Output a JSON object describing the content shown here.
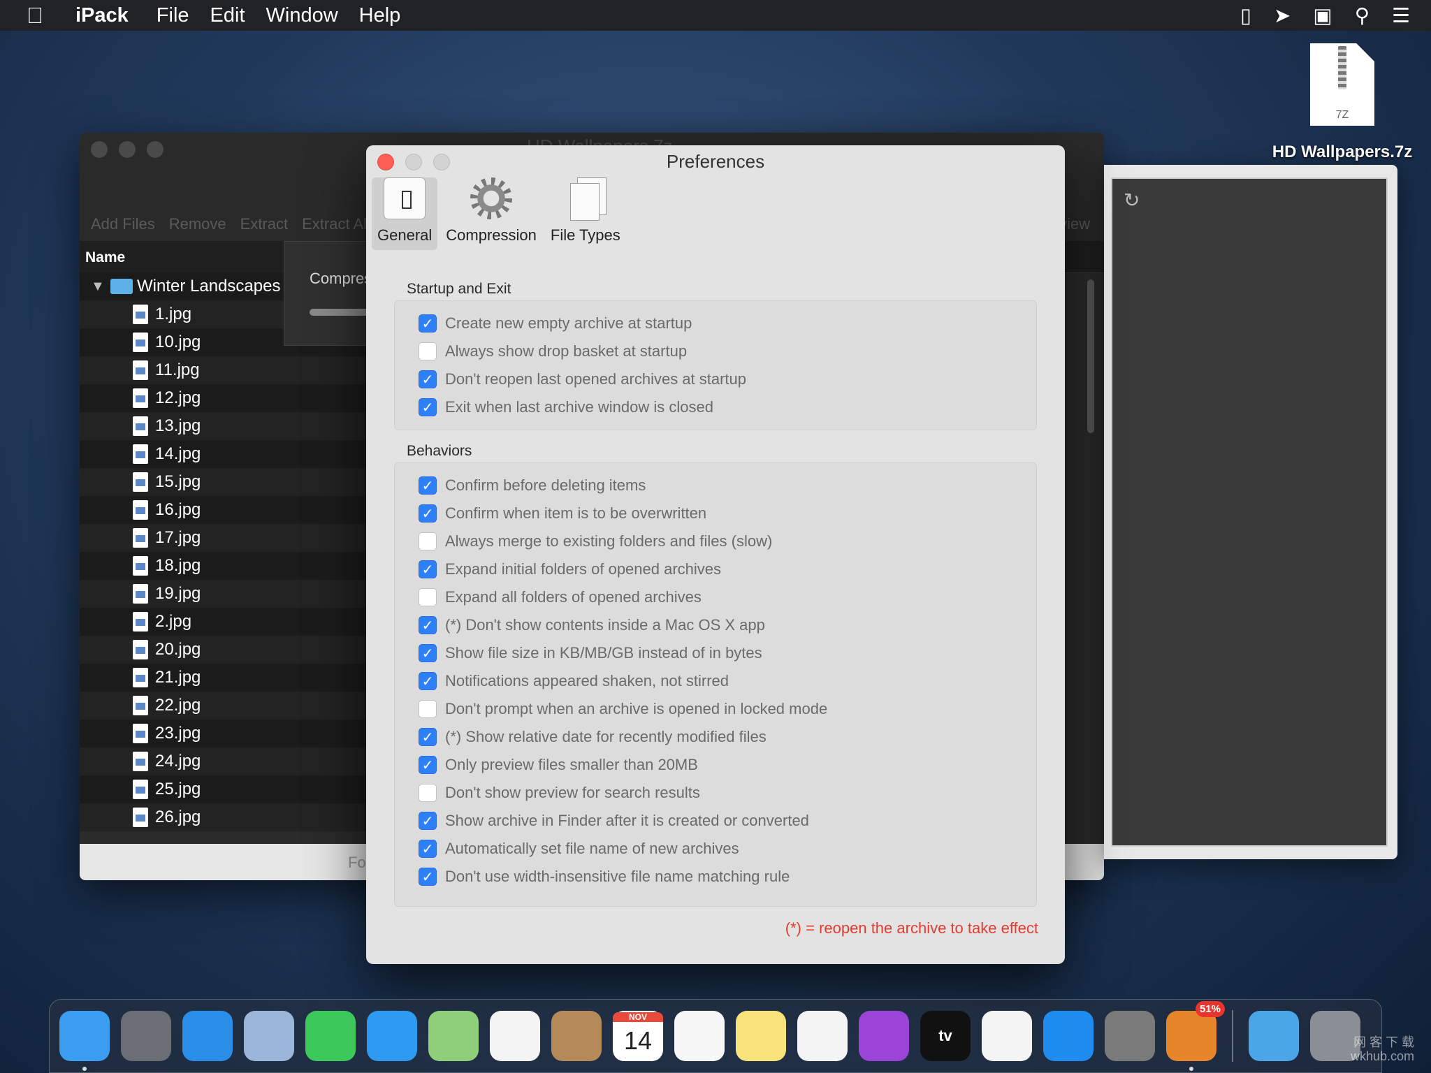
{
  "menubar": {
    "apple": "",
    "app": "iPack",
    "items": [
      "File",
      "Edit",
      "Window",
      "Help"
    ]
  },
  "desktop_file": {
    "ext": "7Z",
    "label": "HD Wallpapers.7z"
  },
  "main_window": {
    "title": "HD Wallpapers.7z",
    "toolbar": [
      "Add Files",
      "Remove",
      "Extract",
      "Extract All"
    ],
    "toolbar_right": "Preview",
    "column_name": "Name",
    "folder": "Winter Landscapes",
    "files": [
      "1.jpg",
      "10.jpg",
      "11.jpg",
      "12.jpg",
      "13.jpg",
      "14.jpg",
      "15.jpg",
      "16.jpg",
      "17.jpg",
      "18.jpg",
      "19.jpg",
      "2.jpg",
      "20.jpg",
      "21.jpg",
      "22.jpg",
      "23.jpg",
      "24.jpg",
      "25.jpg",
      "26.jpg"
    ],
    "compress_sheet": "Compressing",
    "bottom_text": "Fo"
  },
  "preferences": {
    "title": "Preferences",
    "tabs": [
      {
        "label": "General",
        "icon": "switch-icon",
        "active": true
      },
      {
        "label": "Compression",
        "icon": "gear-icon",
        "active": false
      },
      {
        "label": "File Types",
        "icon": "documents-icon",
        "active": false
      }
    ],
    "sections": [
      {
        "title": "Startup and Exit",
        "options": [
          {
            "label": "Create new empty archive at startup",
            "checked": true
          },
          {
            "label": "Always show drop basket at startup",
            "checked": false
          },
          {
            "label": "Don't reopen last opened archives at startup",
            "checked": true
          },
          {
            "label": "Exit when last archive window is closed",
            "checked": true
          }
        ]
      },
      {
        "title": "Behaviors",
        "options": [
          {
            "label": "Confirm before deleting items",
            "checked": true
          },
          {
            "label": "Confirm when item is to be overwritten",
            "checked": true
          },
          {
            "label": "Always merge to existing folders and files (slow)",
            "checked": false
          },
          {
            "label": "Expand initial folders of opened archives",
            "checked": true
          },
          {
            "label": "Expand all folders of opened archives",
            "checked": false
          },
          {
            "label": "(*) Don't show contents inside a Mac OS X app",
            "checked": true
          },
          {
            "label": "Show file size in KB/MB/GB instead of in bytes",
            "checked": true
          },
          {
            "label": "Notifications appeared shaken, not stirred",
            "checked": true
          },
          {
            "label": "Don't prompt when an archive is opened in locked mode",
            "checked": false
          },
          {
            "label": "(*) Show relative date for recently modified files",
            "checked": true
          },
          {
            "label": "Only preview files smaller than 20MB",
            "checked": true
          },
          {
            "label": "Don't show preview for search results",
            "checked": false
          },
          {
            "label": "Show archive in Finder after it is created or converted",
            "checked": true
          },
          {
            "label": "Automatically set file name of new archives",
            "checked": true
          },
          {
            "label": "Don't use width-insensitive file name matching rule",
            "checked": true
          }
        ]
      }
    ],
    "note": "(*) = reopen the archive to take effect"
  },
  "dock": {
    "apps": [
      {
        "name": "finder-icon",
        "color": "#3a9df0",
        "text": ""
      },
      {
        "name": "launchpad-icon",
        "color": "#6b6e75",
        "text": ""
      },
      {
        "name": "safari-icon",
        "color": "#2a8ee8",
        "text": ""
      },
      {
        "name": "mail-icon",
        "color": "#9ab6d8",
        "text": ""
      },
      {
        "name": "facetime-icon",
        "color": "#3cc85a",
        "text": ""
      },
      {
        "name": "messages-icon",
        "color": "#2f9bf0",
        "text": ""
      },
      {
        "name": "maps-icon",
        "color": "#8fcf7a",
        "text": ""
      },
      {
        "name": "photos-icon",
        "color": "#f4f4f4",
        "text": ""
      },
      {
        "name": "contacts-icon",
        "color": "#b48a58",
        "text": ""
      },
      {
        "name": "calendar-icon",
        "color": "#ffffff",
        "text": "14",
        "month": "NOV"
      },
      {
        "name": "reminders-icon",
        "color": "#f7f7f7",
        "text": ""
      },
      {
        "name": "notes-icon",
        "color": "#f8e27a",
        "text": ""
      },
      {
        "name": "music-icon",
        "color": "#f4f4f4",
        "text": ""
      },
      {
        "name": "podcasts-icon",
        "color": "#9a45d8",
        "text": ""
      },
      {
        "name": "tv-icon",
        "color": "#111111",
        "text": "tv"
      },
      {
        "name": "news-icon",
        "color": "#f4f4f4",
        "text": ""
      },
      {
        "name": "app-store-icon",
        "color": "#1f8df0",
        "text": ""
      },
      {
        "name": "system-preferences-icon",
        "color": "#7a7a7a",
        "text": ""
      },
      {
        "name": "ipack-icon",
        "color": "#e7852a",
        "text": "",
        "badge": "51%"
      }
    ],
    "right": [
      {
        "name": "downloads-folder-icon",
        "color": "#4aa6e6"
      },
      {
        "name": "trash-icon",
        "color": "#8a8f96"
      }
    ]
  },
  "watermark": [
    "网 客 下 载",
    "wkhub.com"
  ]
}
